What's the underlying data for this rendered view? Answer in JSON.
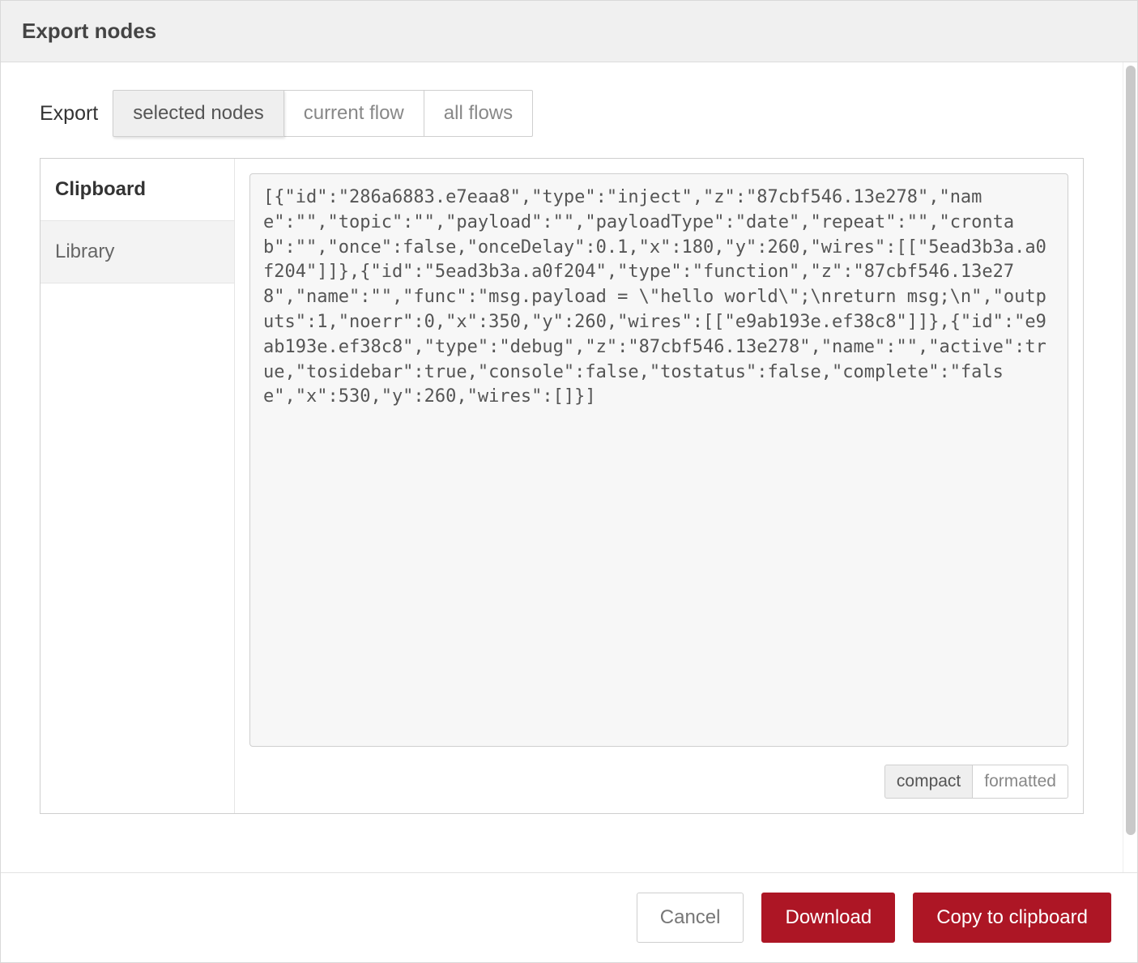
{
  "header": {
    "title": "Export nodes"
  },
  "scope": {
    "label": "Export",
    "options": {
      "selected": "selected nodes",
      "current": "current flow",
      "all": "all flows"
    }
  },
  "sidebar": {
    "clipboard": "Clipboard",
    "library": "Library"
  },
  "export": {
    "json_text": "[{\"id\":\"286a6883.e7eaa8\",\"type\":\"inject\",\"z\":\"87cbf546.13e278\",\"name\":\"\",\"topic\":\"\",\"payload\":\"\",\"payloadType\":\"date\",\"repeat\":\"\",\"crontab\":\"\",\"once\":false,\"onceDelay\":0.1,\"x\":180,\"y\":260,\"wires\":[[\"5ead3b3a.a0f204\"]]},{\"id\":\"5ead3b3a.a0f204\",\"type\":\"function\",\"z\":\"87cbf546.13e278\",\"name\":\"\",\"func\":\"msg.payload = \\\"hello world\\\";\\nreturn msg;\\n\",\"outputs\":1,\"noerr\":0,\"x\":350,\"y\":260,\"wires\":[[\"e9ab193e.ef38c8\"]]},{\"id\":\"e9ab193e.ef38c8\",\"type\":\"debug\",\"z\":\"87cbf546.13e278\",\"name\":\"\",\"active\":true,\"tosidebar\":true,\"console\":false,\"tostatus\":false,\"complete\":\"false\",\"x\":530,\"y\":260,\"wires\":[]}]"
  },
  "format": {
    "compact": "compact",
    "formatted": "formatted"
  },
  "footer": {
    "cancel": "Cancel",
    "download": "Download",
    "copy": "Copy to clipboard"
  }
}
